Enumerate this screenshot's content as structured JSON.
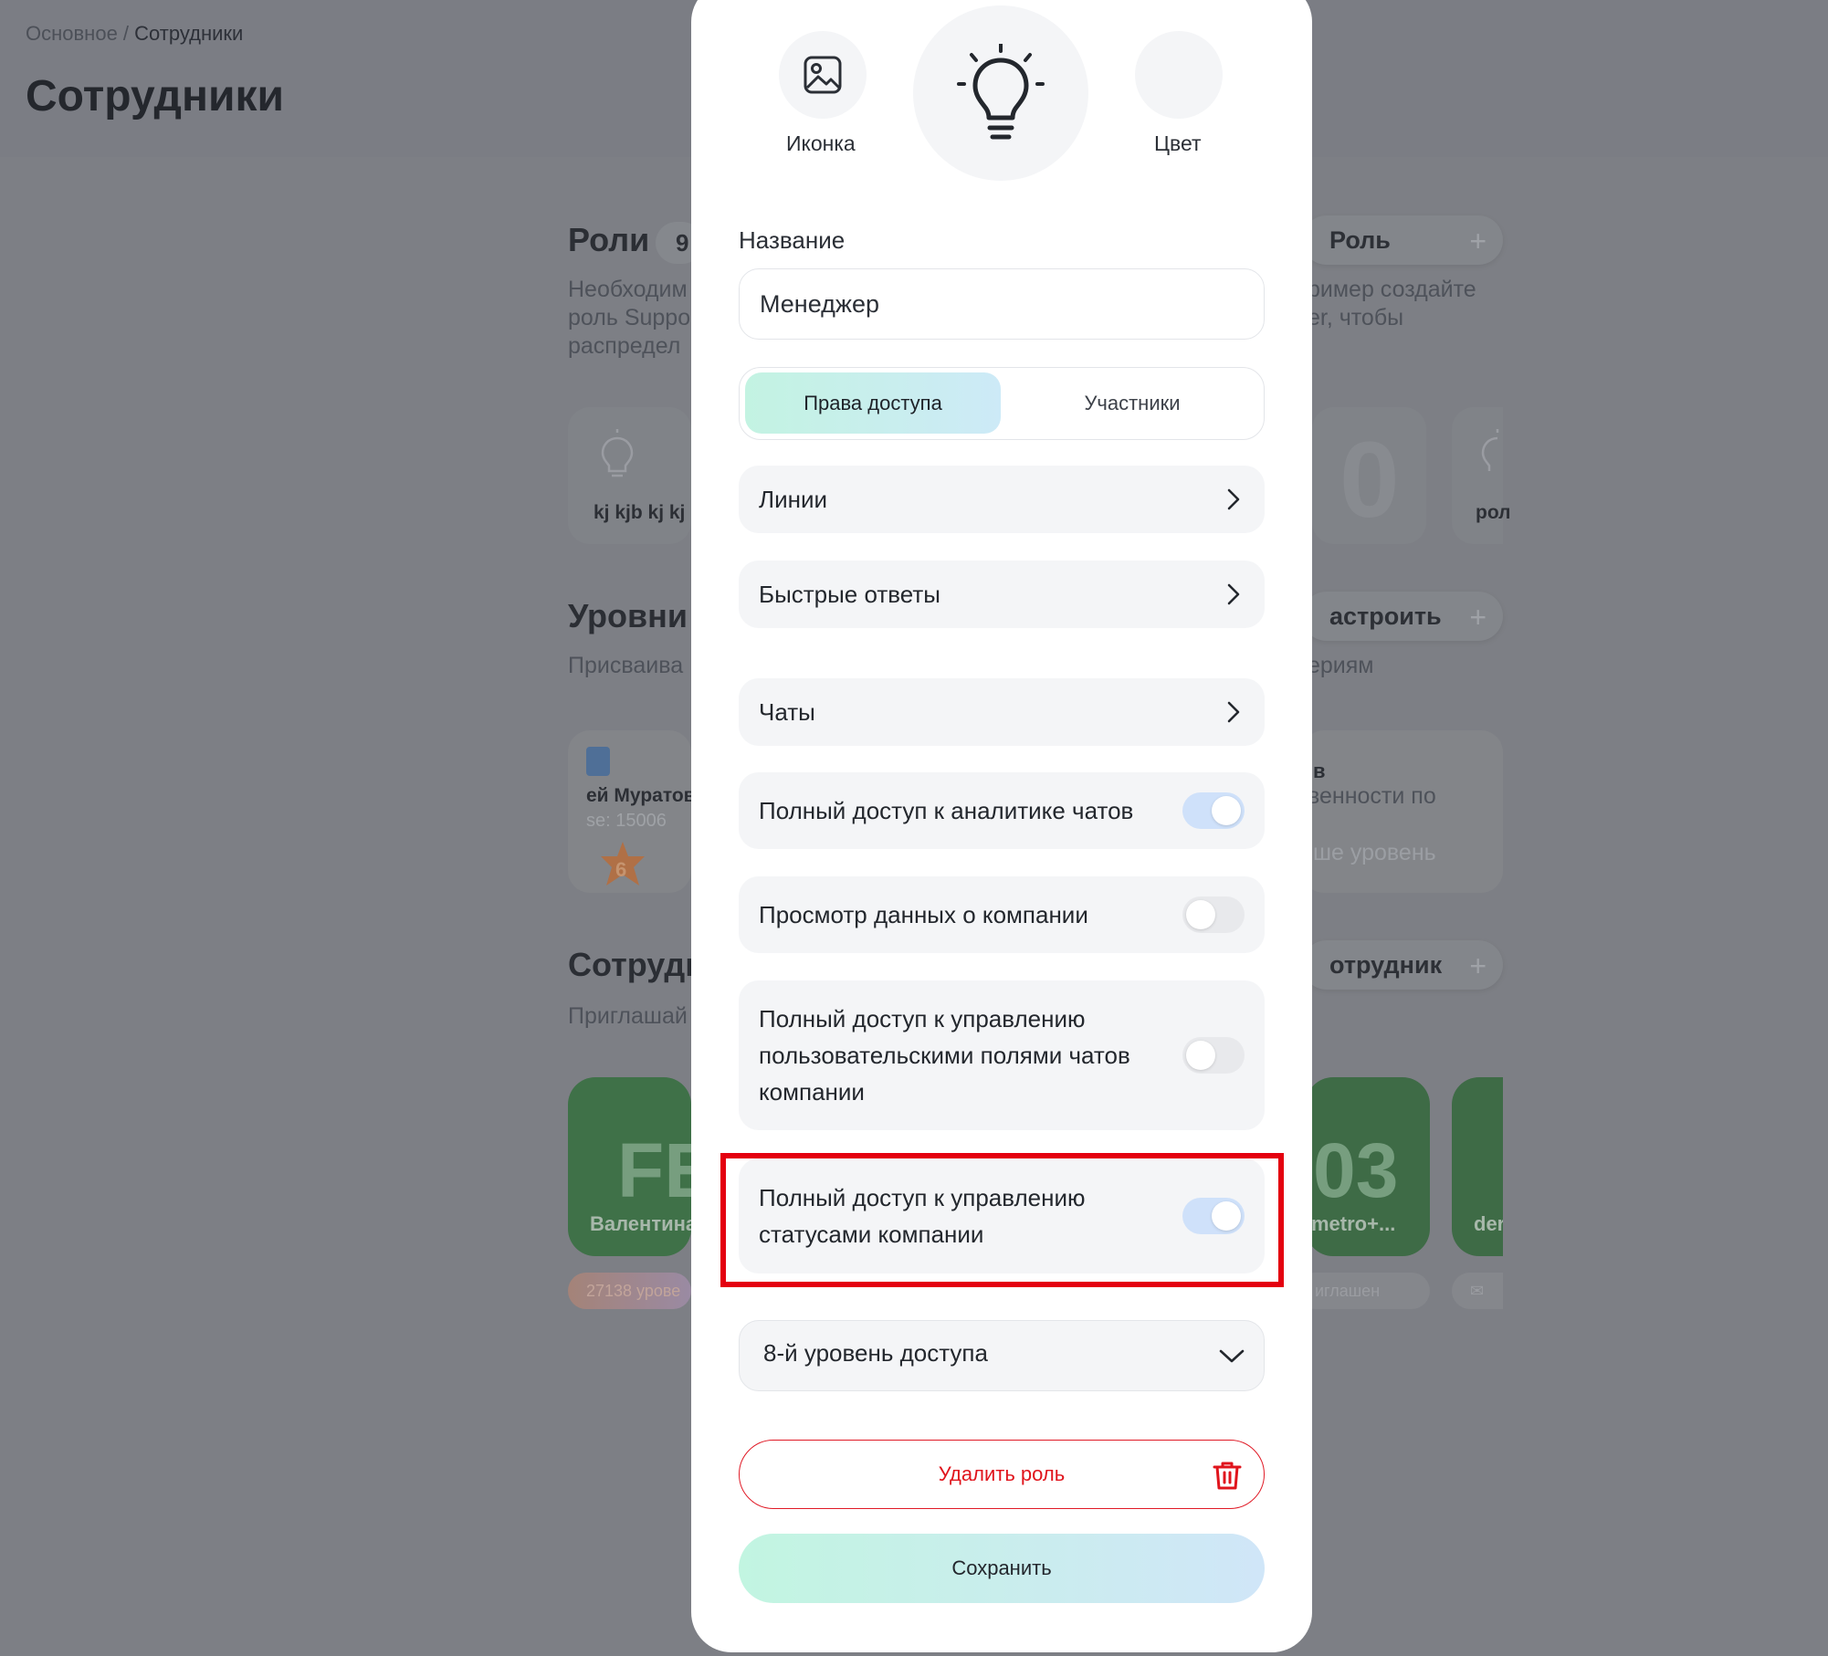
{
  "background": {
    "breadcrumb": {
      "root": "Основное",
      "separator": " / ",
      "current": "Сотрудники"
    },
    "page_title": "Сотрудники",
    "roles": {
      "title": "Роли",
      "count": "9",
      "add_button": "Роль",
      "desc_left": [
        "Необходим",
        "роль Suppo",
        "распредел"
      ],
      "desc_right": [
        "ример создайте",
        "er, чтобы"
      ],
      "card_left_label": "kj kjb kj kj",
      "card_right_label": "рол",
      "card_mid_glyph": "0"
    },
    "levels": {
      "title": "Уровни ,",
      "add_button": "астроить",
      "desc_left": "Присваива",
      "desc_right": "ериям",
      "card_left_name": "ей Муратов",
      "card_left_sub": "se: 15006",
      "card_left_badge": "6",
      "card_right_line1": "в",
      "card_right_line2": "венности по",
      "card_right_line3": "ше уровень"
    },
    "employees": {
      "title": "Сотрудн",
      "add_button": "отрудник",
      "desc_left": "Приглашай",
      "card1_initials": "FE",
      "card1_name": "Валентина",
      "card1_tag": "27138 урове",
      "card2_initials": "03",
      "card2_name": "metro+...",
      "card2_tag": "иглашен",
      "card3_name": "der",
      "card3_tag": "✉"
    }
  },
  "modal": {
    "icon_label": "Иконка",
    "color_label": "Цвет",
    "name_label": "Название",
    "name_value": "Менеджер",
    "tabs": {
      "access": "Права доступа",
      "members": "Участники"
    },
    "rows": [
      {
        "label": "Линии"
      },
      {
        "label": "Быстрые ответы"
      },
      {
        "label": "Чаты"
      }
    ],
    "toggles": [
      {
        "label": "Полный доступ к аналитике чатов",
        "on": true
      },
      {
        "label": "Просмотр данных о компании",
        "on": false
      },
      {
        "label_lines": [
          "Полный доступ к управлению",
          "пользовательскими полями чатов",
          "компании"
        ],
        "on": false
      },
      {
        "label_lines": [
          "Полный доступ к управлению",
          "статусами компании"
        ],
        "on": true
      }
    ],
    "access_level": "8-й уровень доступа",
    "delete_label": "Удалить роль",
    "save_label": "Сохранить"
  },
  "colors": {
    "overlay": "#7b7d84",
    "delete": "#e0141c",
    "highlight": "#e4000f",
    "toggle_on": "#cfe1fa",
    "accent_gradient_start": "#c3f3e2",
    "accent_gradient_end": "#cdeaf7"
  }
}
